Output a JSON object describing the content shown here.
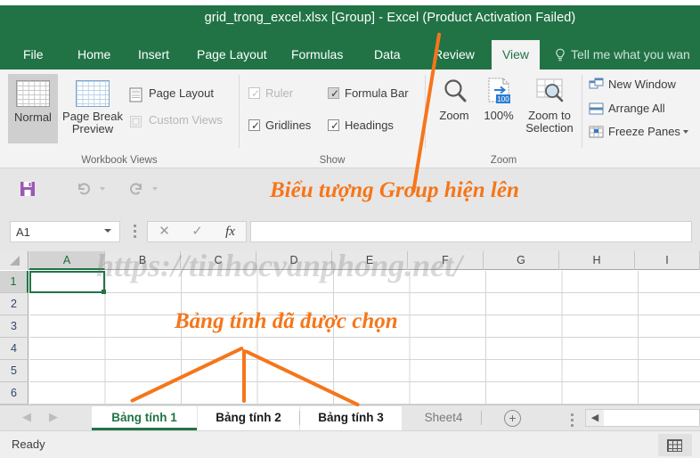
{
  "window": {
    "title": "grid_trong_excel.xlsx  [Group] - Excel (Product Activation Failed)"
  },
  "ribbon": {
    "tabs": [
      {
        "label": "File",
        "active": false
      },
      {
        "label": "Home",
        "active": false
      },
      {
        "label": "Insert",
        "active": false
      },
      {
        "label": "Page Layout",
        "active": false
      },
      {
        "label": "Formulas",
        "active": false
      },
      {
        "label": "Data",
        "active": false
      },
      {
        "label": "Review",
        "active": false
      },
      {
        "label": "View",
        "active": true
      }
    ],
    "tell_me": "Tell me what you wan",
    "groups": {
      "workbook_views": {
        "label": "Workbook Views",
        "normal": "Normal",
        "page_break_preview": "Page Break Preview",
        "page_layout": "Page Layout",
        "custom_views": "Custom Views"
      },
      "show": {
        "label": "Show",
        "ruler": "Ruler",
        "formula_bar": "Formula Bar",
        "gridlines": "Gridlines",
        "headings": "Headings"
      },
      "zoom": {
        "label": "Zoom",
        "zoom": "Zoom",
        "hundred": "100%",
        "zoom_to_selection": "Zoom to Selection"
      },
      "window": {
        "new_window": "New Window",
        "arrange_all": "Arrange All",
        "freeze_panes": "Freeze Panes"
      }
    }
  },
  "formula_bar": {
    "name_box_value": "A1",
    "formula_value": "",
    "cancel": "✕",
    "enter": "✓",
    "fx": "fx"
  },
  "grid": {
    "columns": [
      "A",
      "B",
      "C",
      "D",
      "E",
      "F",
      "G",
      "H",
      "I"
    ],
    "rows": [
      "1",
      "2",
      "3",
      "4",
      "5",
      "6"
    ],
    "active_cell": "A1"
  },
  "watermark": "https://tinhocvanphong.net/",
  "sheet_tabs": [
    {
      "label": "Bảng tính 1",
      "state": "active"
    },
    {
      "label": "Bảng tính 2",
      "state": "grouped"
    },
    {
      "label": "Bảng tính 3",
      "state": "grouped"
    },
    {
      "label": "Sheet4",
      "state": "inactive"
    }
  ],
  "status_bar": {
    "text": "Ready"
  },
  "annotations": {
    "group_icon": "Biểu tượng Group hiện lên",
    "sheets_selected": "Bảng tính đã được chọn"
  },
  "colors": {
    "brand_green": "#217346",
    "annotation_orange": "#f5761a"
  }
}
